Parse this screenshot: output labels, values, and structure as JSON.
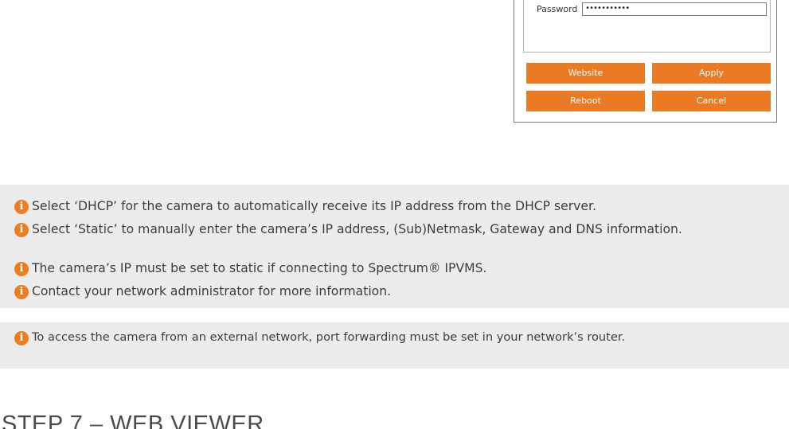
{
  "dialog": {
    "password_label": "Password",
    "password_value": "•••••••••••",
    "buttons": {
      "website": "Website",
      "apply": "Apply",
      "reboot": "Reboot",
      "cancel": "Cancel"
    },
    "button_color": "#ea7a24"
  },
  "notes_network": [
    {
      "icon": "info-icon",
      "text": "Select ‘DHCP’ for the camera to automatically receive its IP address from the DHCP server."
    },
    {
      "icon": "info-icon",
      "text": "Select ‘Static’ to manually enter the camera’s IP address, (Sub)Netmask, Gateway and DNS information."
    },
    {
      "icon": "info-icon",
      "text": "The camera’s IP must be set to static if connecting to Spectrum® IPVMS."
    },
    {
      "icon": "info-icon",
      "text": "Contact your network administrator for more information."
    }
  ],
  "note_external": {
    "icon": "info-icon",
    "text": "To access the camera from an external network, port forwarding must be set in your network’s router."
  },
  "step_heading": "STEP 7 – WEB VIEWER",
  "colors": {
    "accent": "#ee7d22",
    "info_background": "#ececec"
  }
}
